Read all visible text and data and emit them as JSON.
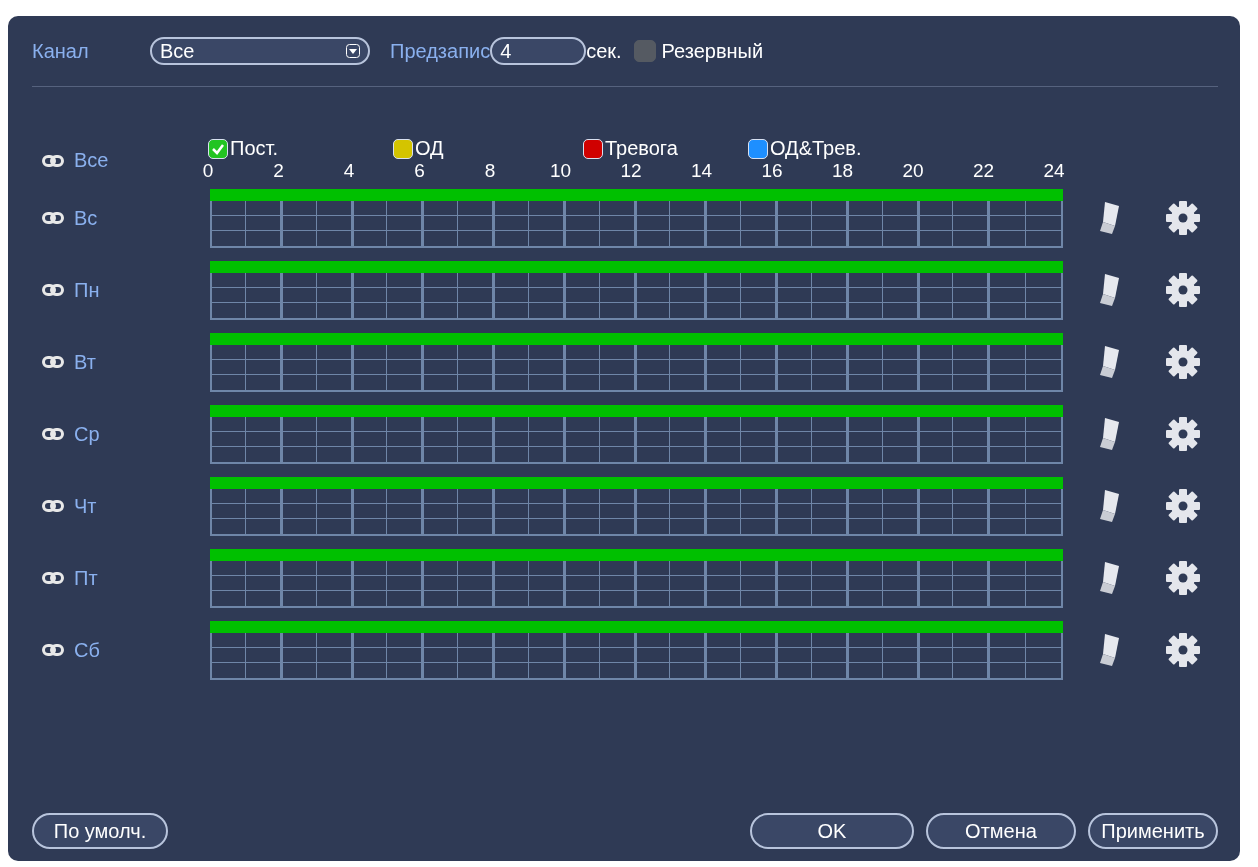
{
  "header": {
    "channel_label": "Канал",
    "channel_value": "Все",
    "prerecord_label": "Предзапис",
    "prerecord_value": "4",
    "prerecord_unit": "сек.",
    "backup": {
      "label": "Резервный",
      "checked": false
    }
  },
  "legend": [
    {
      "label": "Пост.",
      "color": "#22c422",
      "checked": true
    },
    {
      "label": "ОД",
      "color": "#d4c400",
      "checked": false
    },
    {
      "label": "Тревога",
      "color": "#d00000",
      "checked": false
    },
    {
      "label": "ОД&Трев.",
      "color": "#1e8fff",
      "checked": false
    }
  ],
  "all_label": "Все",
  "hours": [
    "0",
    "2",
    "4",
    "6",
    "8",
    "10",
    "12",
    "14",
    "16",
    "18",
    "20",
    "22",
    "24"
  ],
  "days": [
    {
      "label": "Вс",
      "level": 1
    },
    {
      "label": "Пн",
      "level": 1
    },
    {
      "label": "Вт",
      "level": 1
    },
    {
      "label": "Ср",
      "level": 1
    },
    {
      "label": "Чт",
      "level": 1
    },
    {
      "label": "Пт",
      "level": 1
    },
    {
      "label": "Сб",
      "level": 1
    }
  ],
  "buttons_left": [
    "По умолч."
  ],
  "buttons_right": [
    "OK",
    "Отмена",
    "Применить"
  ]
}
